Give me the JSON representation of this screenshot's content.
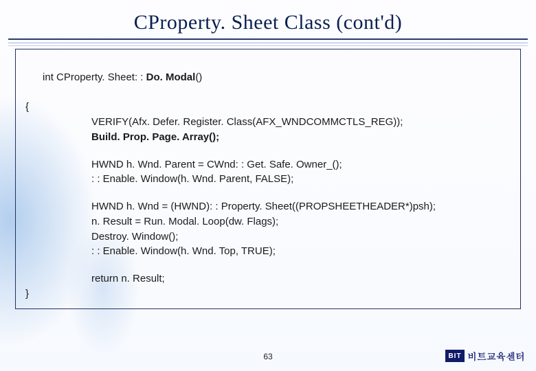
{
  "title": "CProperty. Sheet Class (cont'd)",
  "code": {
    "l1_pre": "int CProperty. Sheet: : ",
    "l1_bold": "Do. Modal",
    "l1_post": "()",
    "l2": "{",
    "l3": "VERIFY(Afx. Defer. Register. Class(AFX_WNDCOMMCTLS_REG));",
    "l4": "Build. Prop. Page. Array();",
    "l5": "HWND h. Wnd. Parent = CWnd: : Get. Safe. Owner_();",
    "l6": ": : Enable. Window(h. Wnd. Parent, FALSE);",
    "l7": "HWND h. Wnd = (HWND): : Property. Sheet((PROPSHEETHEADER*)psh);",
    "l8": "n. Result = Run. Modal. Loop(dw. Flags);",
    "l9": "Destroy. Window();",
    "l10": ": : Enable. Window(h. Wnd. Top, TRUE);",
    "l11": "return n. Result;",
    "l12": "}"
  },
  "page_number": "63",
  "footer": {
    "logo_mark": "BIT",
    "logo_text": "비트교육센터"
  }
}
